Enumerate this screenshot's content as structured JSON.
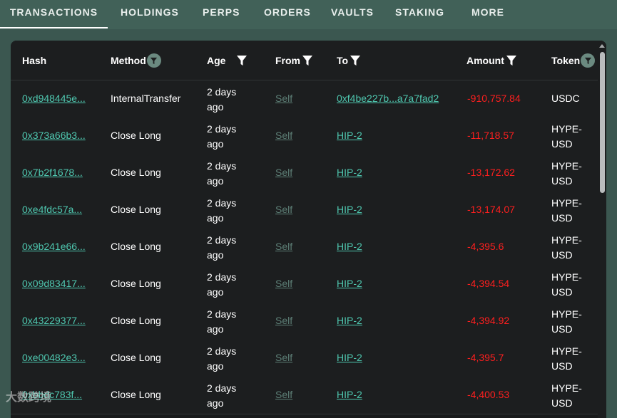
{
  "tabs": [
    {
      "label": "TRANSACTIONS",
      "active": true
    },
    {
      "label": "HOLDINGS"
    },
    {
      "label": "PERPS"
    },
    {
      "label": "ORDERS"
    },
    {
      "label": "VAULTS"
    },
    {
      "label": "STAKING"
    },
    {
      "label": "MORE"
    }
  ],
  "table": {
    "columns": [
      "Hash",
      "Method",
      "Age",
      "From",
      "To",
      "Amount",
      "Token"
    ],
    "rows": [
      {
        "hash": "0xd948445e...",
        "method": "InternalTransfer",
        "age": "2 days ago",
        "from": "Self",
        "to": "0xf4be227b...a7a7fad2",
        "amount": "-910,757.84",
        "token": "USDC"
      },
      {
        "hash": "0x373a66b3...",
        "method": "Close Long",
        "age": "2 days ago",
        "from": "Self",
        "to": "HIP-2",
        "amount": "-11,718.57",
        "token": "HYPE-USD"
      },
      {
        "hash": "0x7b2f1678...",
        "method": "Close Long",
        "age": "2 days ago",
        "from": "Self",
        "to": "HIP-2",
        "amount": "-13,172.62",
        "token": "HYPE-USD"
      },
      {
        "hash": "0xe4fdc57a...",
        "method": "Close Long",
        "age": "2 days ago",
        "from": "Self",
        "to": "HIP-2",
        "amount": "-13,174.07",
        "token": "HYPE-USD"
      },
      {
        "hash": "0x9b241e66...",
        "method": "Close Long",
        "age": "2 days ago",
        "from": "Self",
        "to": "HIP-2",
        "amount": "-4,395.6",
        "token": "HYPE-USD"
      },
      {
        "hash": "0x09d83417...",
        "method": "Close Long",
        "age": "2 days ago",
        "from": "Self",
        "to": "HIP-2",
        "amount": "-4,394.54",
        "token": "HYPE-USD"
      },
      {
        "hash": "0x43229377...",
        "method": "Close Long",
        "age": "2 days ago",
        "from": "Self",
        "to": "HIP-2",
        "amount": "-4,394.92",
        "token": "HYPE-USD"
      },
      {
        "hash": "0xe00482e3...",
        "method": "Close Long",
        "age": "2 days ago",
        "from": "Self",
        "to": "HIP-2",
        "amount": "-4,395.7",
        "token": "HYPE-USD"
      },
      {
        "hash": "0xbbdc783f...",
        "method": "Close Long",
        "age": "2 days ago",
        "from": "Self",
        "to": "HIP-2",
        "amount": "-4,400.53",
        "token": "HYPE-USD"
      }
    ]
  },
  "watermark": "大数跨境",
  "colors": {
    "link": "#4fc8b0",
    "negative_amount": "#ff1f1f",
    "nav_background": "#416158"
  }
}
